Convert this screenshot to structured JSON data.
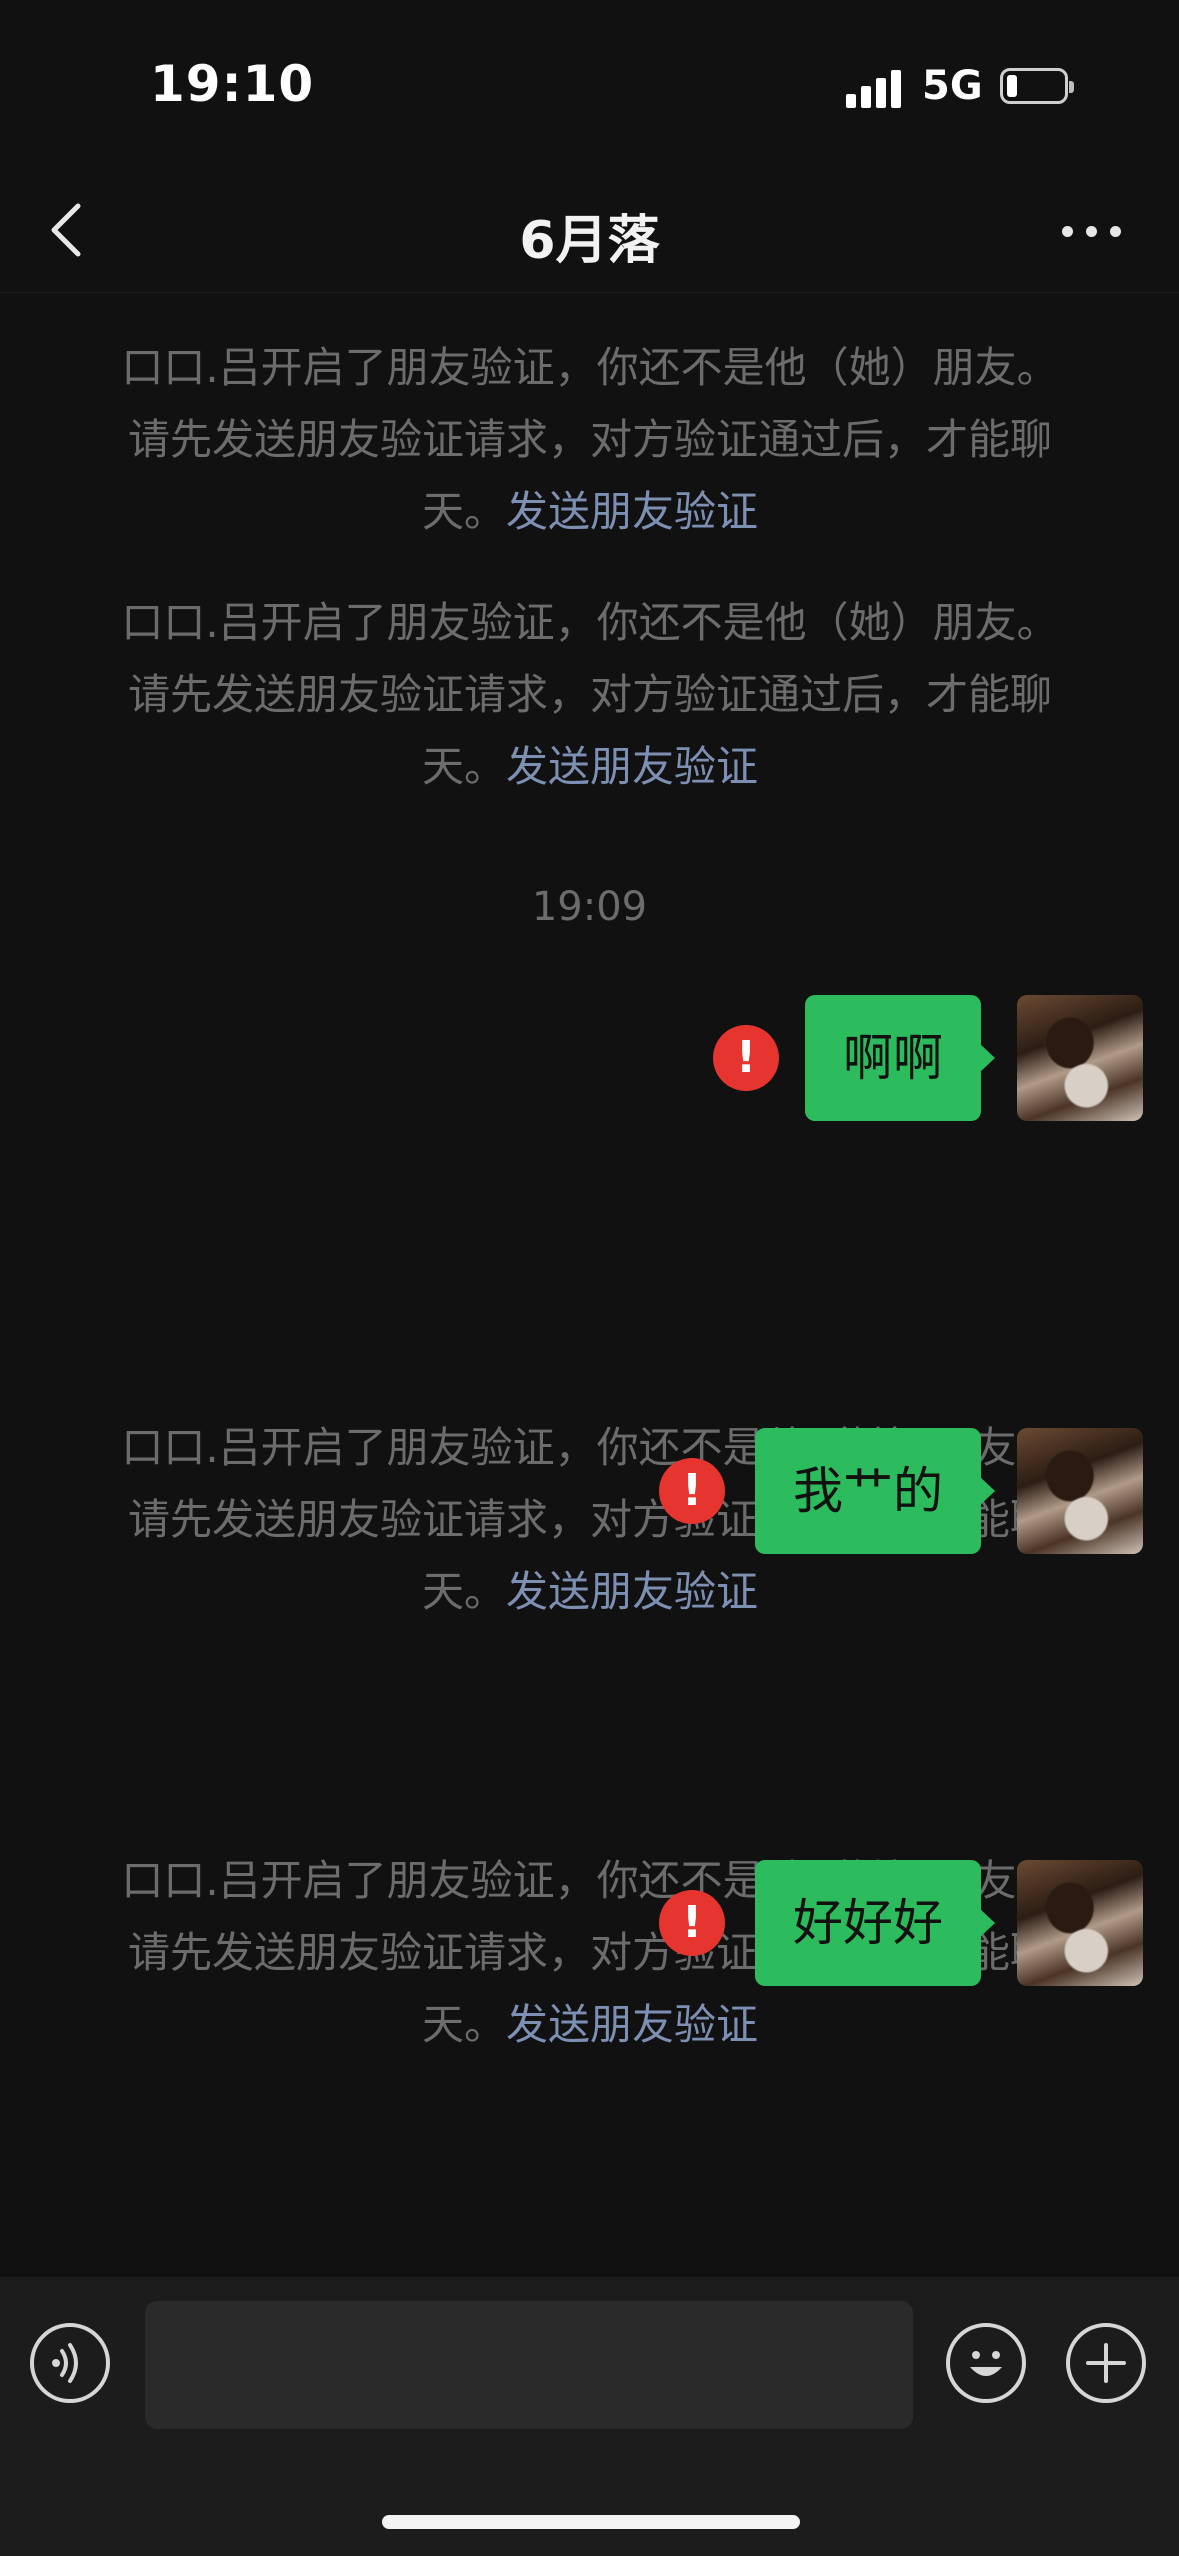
{
  "status_bar": {
    "time": "19:10",
    "network": "5G"
  },
  "nav": {
    "title": "6月落"
  },
  "notice": {
    "line1": "口口.吕开启了朋友验证，你还不是他（她）朋友。",
    "line2": "请先发送朋友验证请求，对方验证通过后，才能聊",
    "line3_prefix": "天。",
    "link": "发送朋友验证"
  },
  "timestamp": "19:09",
  "messages": [
    {
      "text": "啊啊",
      "status": "failed"
    },
    {
      "text": "我艹的",
      "status": "failed"
    },
    {
      "text": "好好好",
      "status": "failed"
    }
  ],
  "input": {
    "value": ""
  },
  "colors": {
    "bubble": "#2dbc5d",
    "error": "#e6352f",
    "link": "#7d90b3",
    "background": "#111111"
  },
  "icons": [
    "back-icon",
    "more-icon",
    "error-icon",
    "voice-icon",
    "emoji-icon",
    "plus-icon"
  ]
}
